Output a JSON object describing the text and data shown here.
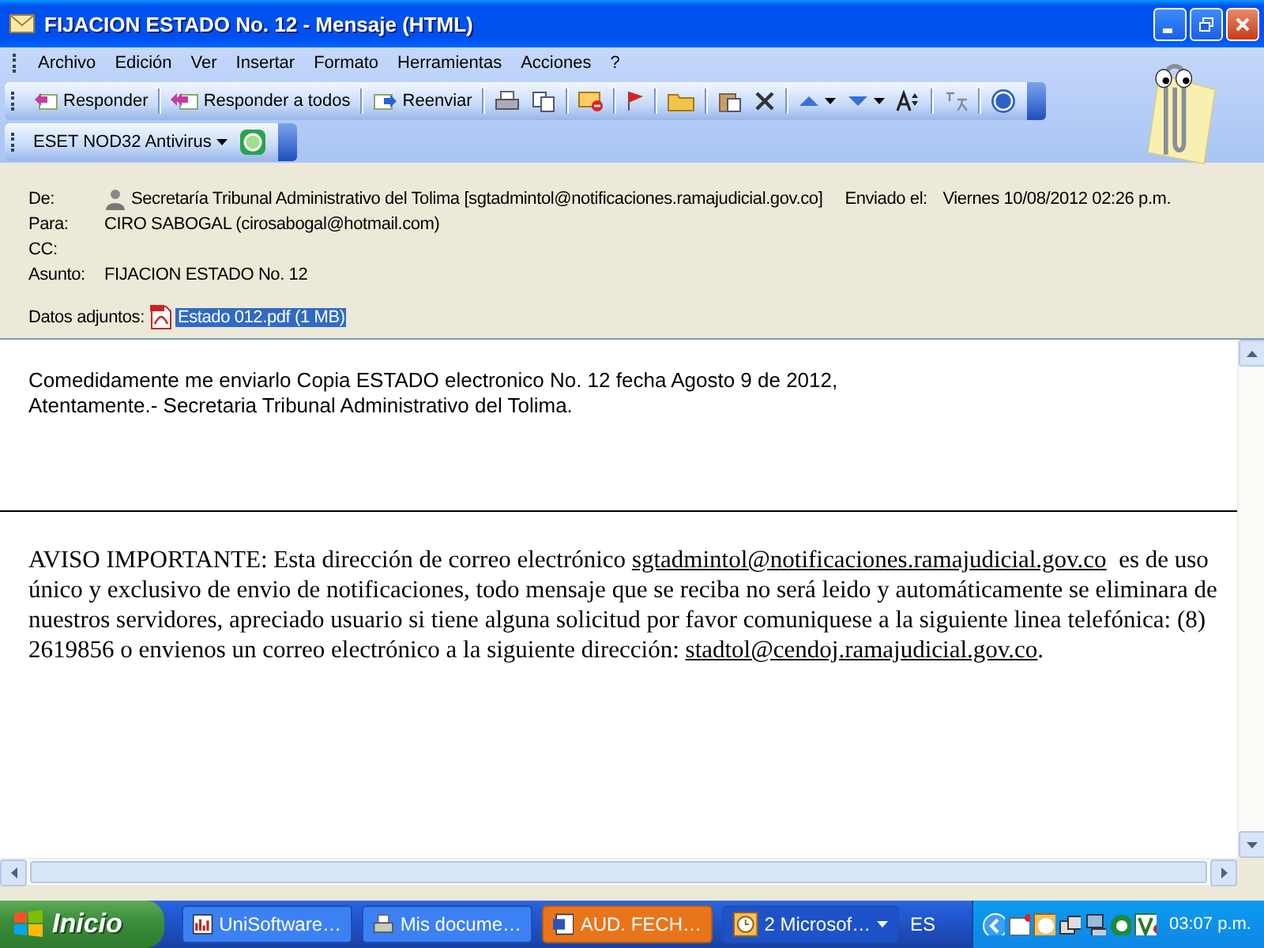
{
  "window": {
    "title": "FIJACION ESTADO No. 12 - Mensaje (HTML)"
  },
  "menu": [
    {
      "label": "Archivo"
    },
    {
      "label": "Edición"
    },
    {
      "label": "Ver"
    },
    {
      "label": "Insertar"
    },
    {
      "label": "Formato"
    },
    {
      "label": "Herramientas"
    },
    {
      "label": "Acciones"
    },
    {
      "label": "?"
    }
  ],
  "toolbar": [
    {
      "label": "Responder"
    },
    {
      "label": "Responder a todos"
    },
    {
      "label": "Reenviar"
    }
  ],
  "addin_toolbar": {
    "label": "ESET NOD32 Antivirus"
  },
  "header": {
    "fields": [
      {
        "kind": "sender",
        "label": "De:",
        "value": "Secretaría Tribunal Administrativo del Tolima [sgtadmintol@notificaciones.ramajudicial.gov.co]"
      },
      {
        "kind": "plain",
        "label": "Para:",
        "value": "CIRO SABOGAL (cirosabogal@hotmail.com)"
      },
      {
        "kind": "plain",
        "label": "CC:"
      },
      {
        "kind": "plain",
        "label": "Asunto:",
        "value": "FIJACION ESTADO No. 12"
      }
    ],
    "sent": {
      "label": "Enviado el:",
      "value": "Viernes 10/08/2012 02:26 p.m."
    },
    "attachments": {
      "label": "Datos adjuntos:",
      "file": "Estado 012.pdf (1 MB)",
      "selected": true
    }
  },
  "body": {
    "lines": [
      "Comedidamente me enviarlo Copia ESTADO electronico No. 12 fecha Agosto 9 de 2012,",
      "Atentamente.- Secretaria Tribunal Administrativo del Tolima."
    ],
    "notice": [
      {
        "kind": "text",
        "text": "AVISO IMPORTANTE: Esta dirección de correo electrónico "
      },
      {
        "kind": "link",
        "text": "sgtadmintol@notificaciones.ramajudicial.gov.co"
      },
      {
        "kind": "text",
        "text": "  es de uso único y exclusivo de envio de notificaciones, todo mensaje que se reciba no será leido y automáticamente se eliminara de nuestros servidores, apreciado usuario si tiene alguna solicitud por favor comuniquese a la siguiente linea telefónica: (8) 2619856 o envienos un correo electrónico a la siguiente dirección: "
      },
      {
        "kind": "link",
        "text": "stadtol@cendoj.ramajudicial.gov.co"
      },
      {
        "kind": "text",
        "text": "."
      }
    ]
  },
  "taskbar": {
    "start": "Inicio",
    "tasks": [
      {
        "kind": "app",
        "label": "UniSoftware…",
        "selected": false
      },
      {
        "kind": "printer",
        "label": "Mis docume…",
        "selected": false
      },
      {
        "kind": "word",
        "label": "AUD. FECH…",
        "selected": true
      },
      {
        "kind": "group",
        "label": "2 Microsof…",
        "selected": false
      }
    ],
    "language": "ES",
    "clock": "03:07 p.m."
  }
}
